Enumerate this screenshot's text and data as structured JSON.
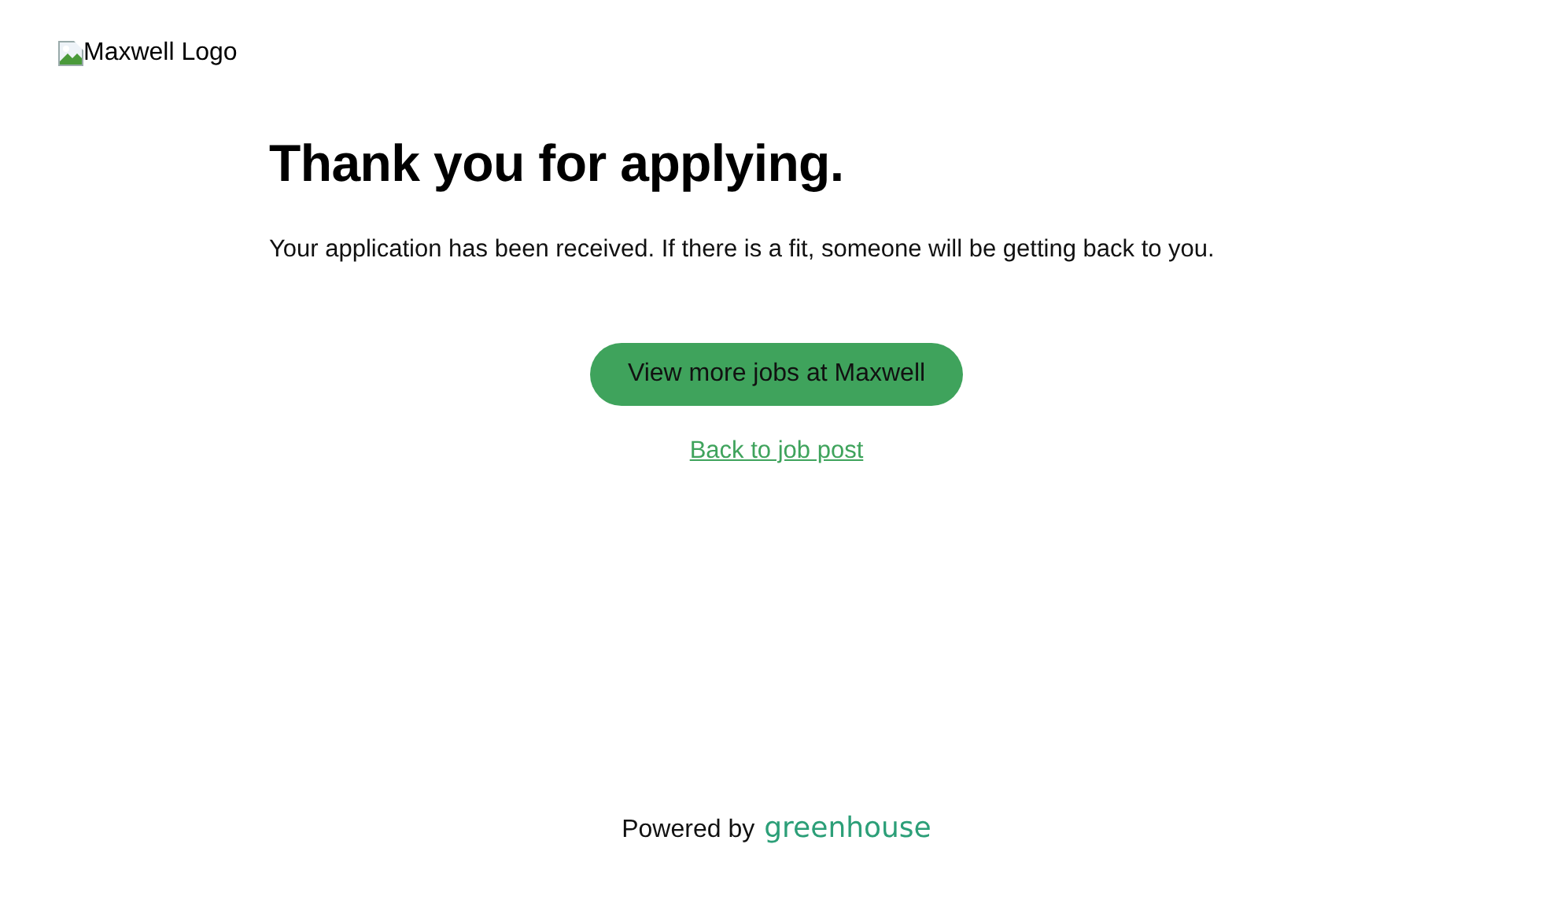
{
  "logo": {
    "alt_text": "Maxwell Logo"
  },
  "heading": "Thank you for applying.",
  "message": "Your application has been received. If there is a fit, someone will be getting back to you.",
  "primary_button": "View more jobs at Maxwell",
  "back_link": "Back to job post",
  "footer": {
    "powered_by": "Powered by",
    "brand": "greenhouse"
  }
}
